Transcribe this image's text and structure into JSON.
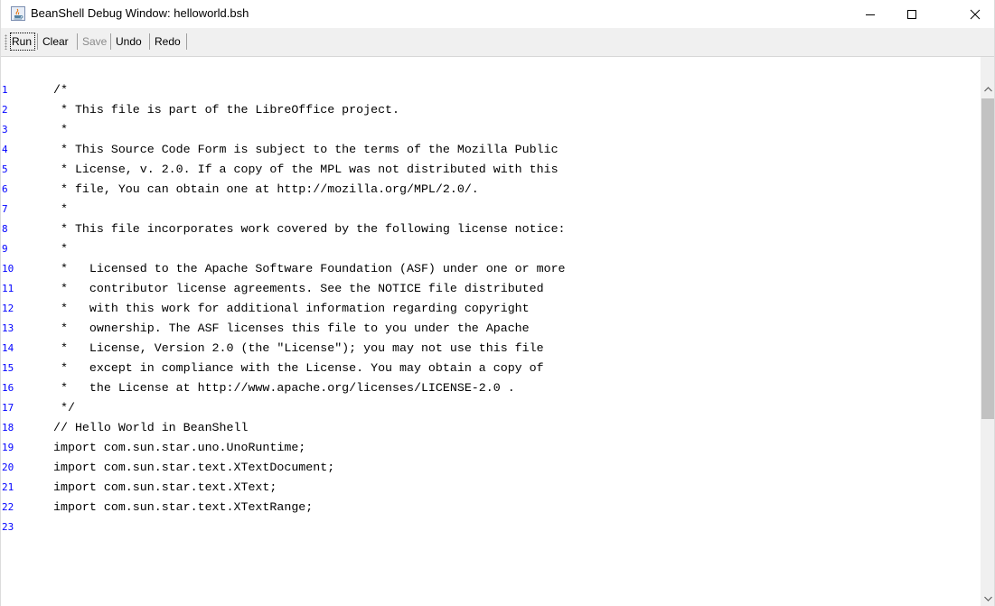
{
  "window": {
    "title": "BeanShell Debug Window: helloworld.bsh",
    "app_icon": "java-cup-icon"
  },
  "toolbar": {
    "run_label": "Run",
    "clear_label": "Clear",
    "save_label": "Save",
    "undo_label": "Undo",
    "redo_label": "Redo"
  },
  "editor": {
    "line_numbers": [
      "1",
      "2",
      "3",
      "4",
      "5",
      "6",
      "7",
      "8",
      "9",
      "10",
      "11",
      "12",
      "13",
      "14",
      "15",
      "16",
      "17",
      "18",
      "19",
      "20",
      "21",
      "22",
      "23"
    ],
    "lines": [
      "/*",
      " * This file is part of the LibreOffice project.",
      " *",
      " * This Source Code Form is subject to the terms of the Mozilla Public",
      " * License, v. 2.0. If a copy of the MPL was not distributed with this",
      " * file, You can obtain one at http://mozilla.org/MPL/2.0/.",
      " *",
      " * This file incorporates work covered by the following license notice:",
      " *",
      " *   Licensed to the Apache Software Foundation (ASF) under one or more",
      " *   contributor license agreements. See the NOTICE file distributed",
      " *   with this work for additional information regarding copyright",
      " *   ownership. The ASF licenses this file to you under the Apache",
      " *   License, Version 2.0 (the \"License\"); you may not use this file",
      " *   except in compliance with the License. You may obtain a copy of",
      " *   the License at http://www.apache.org/licenses/LICENSE-2.0 .",
      " */",
      "// Hello World in BeanShell",
      "import com.sun.star.uno.UnoRuntime;",
      "import com.sun.star.text.XTextDocument;",
      "import com.sun.star.text.XText;",
      "import com.sun.star.text.XTextRange;",
      ""
    ]
  },
  "colors": {
    "line_number": "#0000ff",
    "toolbar_bg": "#f0f0f0",
    "disabled_text": "#8a8a8a"
  }
}
